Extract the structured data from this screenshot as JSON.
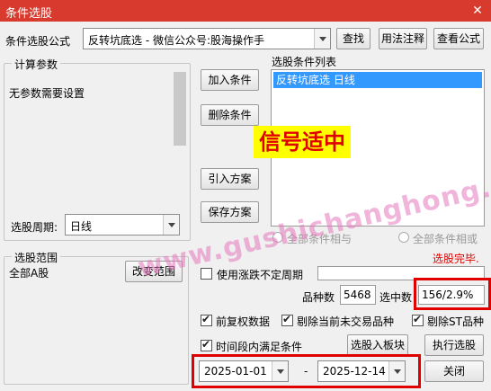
{
  "window": {
    "title": "条件选股"
  },
  "top": {
    "formula_label": "条件选股公式",
    "formula_value": "反转坑底选 - 微信公众号:股海操作手",
    "find_button": "查找",
    "usage_button": "用法注释",
    "view_formula_button": "查看公式"
  },
  "params": {
    "legend": "计算参数",
    "text": "无参数需要设置",
    "period_label": "选股周期:",
    "period_value": "日线"
  },
  "actions": {
    "add": "加入条件",
    "remove": "删除条件",
    "import": "引入方案",
    "save": "保存方案"
  },
  "conditions": {
    "legend": "选股条件列表",
    "items": [
      "反转坑底选  日线"
    ],
    "overlay": "信号适中"
  },
  "logic": {
    "and_label": "全部条件相与",
    "or_label": "全部条件相或",
    "status": "选股完毕."
  },
  "scope": {
    "legend": "选股范围",
    "value": "全部A股",
    "change_button": "改变范围"
  },
  "options": {
    "uncertain_period": "使用涨跌不定周期",
    "count_label": "品种数",
    "count_value": "5468",
    "selected_label": "选中数",
    "selected_value": "156/2.9%",
    "pre_adjust": "前复权数据",
    "exclude_untraded": "剔除当前未交易品种",
    "exclude_st": "剔除ST品种",
    "time_range": "时间段内满足条件",
    "to_block_button": "选股入板块",
    "run_button": "执行选股",
    "start_date": "2025-01-01",
    "dash": "-",
    "end_date": "2025-12-14",
    "close_button": "关闭"
  },
  "watermark": "www.gushichanghong.com",
  "colors": {
    "titlebar": "#d83a2e",
    "overlay_bg": "#ffff00",
    "overlay_text": "#e00000",
    "highlight": "#e00000",
    "list_selected": "#3399ff"
  }
}
